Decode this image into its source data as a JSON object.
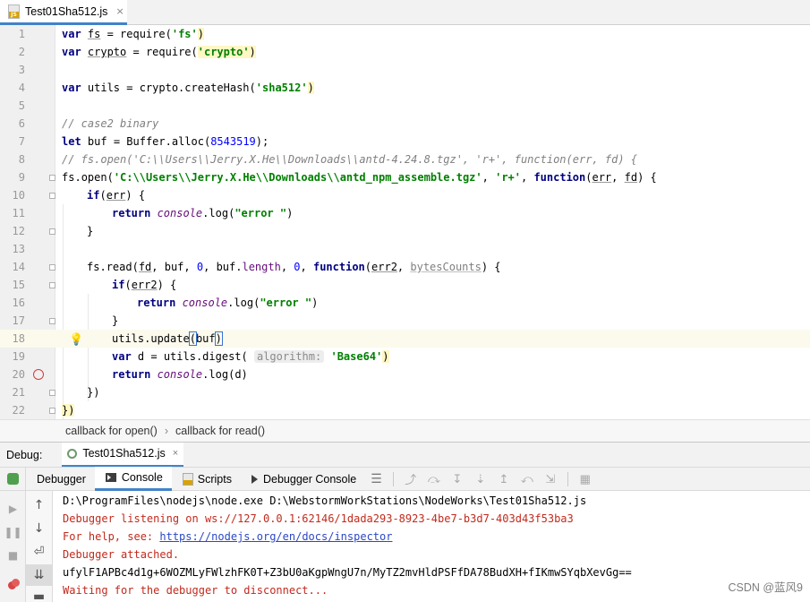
{
  "tab": {
    "filename": "Test01Sha512.js",
    "close": "×"
  },
  "editor": {
    "line_numbers": [
      "1",
      "2",
      "3",
      "4",
      "5",
      "6",
      "7",
      "8",
      "9",
      "10",
      "11",
      "12",
      "13",
      "14",
      "15",
      "16",
      "17",
      "18",
      "19",
      "20",
      "21",
      "22"
    ]
  },
  "code": {
    "l1": {
      "a": "var ",
      "b": "fs",
      "c": " = require(",
      "d": "'fs'",
      "e": ")"
    },
    "l2": {
      "a": "var ",
      "b": "crypto",
      "c": " = require(",
      "d": "'crypto'",
      "e": ")"
    },
    "l4": {
      "a": "var ",
      "b": "utils",
      "c": " = crypto.",
      "d": "createHash",
      "e": "(",
      "f": "'sha512'",
      "g": ")"
    },
    "l6": {
      "a": "// case2 binary"
    },
    "l7": {
      "a": "let ",
      "b": "buf",
      "c": " = Buffer.",
      "d": "alloc",
      "e": "(",
      "f": "8543519",
      "g": ");"
    },
    "l8": {
      "a": "// fs.open('C:\\\\Users\\\\Jerry.X.He\\\\Downloads\\\\antd-4.24.8.tgz', 'r+', function(err, fd) {"
    },
    "l9": {
      "a": "fs.",
      "b": "open",
      "c": "(",
      "d": "'C:\\\\Users\\\\Jerry.X.He\\\\Downloads\\\\antd_npm_assemble.tgz'",
      "e": ", ",
      "f": "'r+'",
      "g": ", ",
      "h": "function",
      "i": "(",
      "j": "err",
      "k": ", ",
      "l": "fd",
      "m": ") {"
    },
    "l10": {
      "a": "if",
      "b": "(",
      "c": "err",
      "d": ") {"
    },
    "l11": {
      "a": "return ",
      "b": "console",
      "c": ".",
      "d": "log",
      "e": "(",
      "f": "\"error \"",
      "g": ")"
    },
    "l12": {
      "a": "}"
    },
    "l14": {
      "a": "fs.",
      "b": "read",
      "c": "(",
      "d": "fd",
      "e": ", ",
      "f": "buf",
      "g": ", ",
      "h": "0",
      "i": ", ",
      "j": "buf",
      "k": ".",
      "l": "length",
      "m": ", ",
      "n": "0",
      "o": ", ",
      "p": "function",
      "q": "(",
      "r": "err2",
      "s": ", ",
      "t": "bytesCounts",
      "u": ") {"
    },
    "l15": {
      "a": "if",
      "b": "(",
      "c": "err2",
      "d": ") {"
    },
    "l16": {
      "a": "return ",
      "b": "console",
      "c": ".",
      "d": "log",
      "e": "(",
      "f": "\"error \"",
      "g": ")"
    },
    "l17": {
      "a": "}"
    },
    "l18": {
      "a": "utils",
      "b": ".",
      "c": "update",
      "d": "(",
      "e": "buf",
      "f": ")"
    },
    "l19": {
      "a": "var ",
      "b": "d",
      "c": " = utils.",
      "d": "digest",
      "e": "( ",
      "f": "algorithm:",
      "g": " ",
      "h": "'Base64'",
      "i": ")"
    },
    "l20": {
      "a": "return ",
      "b": "console",
      "c": ".",
      "d": "log",
      "e": "(",
      "f": "d",
      "g": ")"
    },
    "l21": {
      "a": "})"
    },
    "l22": {
      "a": "})"
    }
  },
  "breadcrumb": {
    "first": "callback for open()",
    "separator": "›",
    "second": "callback for read()"
  },
  "debug": {
    "title": "Debug:",
    "session_tab": "Test01Sha512.js",
    "session_close": "×",
    "toolbar": {
      "debugger": "Debugger",
      "console": "Console",
      "scripts": "Scripts",
      "debugger_console": "Debugger Console",
      "menu": "☰"
    }
  },
  "console": {
    "line1": "D:\\ProgramFiles\\nodejs\\node.exe D:\\WebstormWorkStations\\NodeWorks\\Test01Sha512.js",
    "line2": "Debugger listening on ws://127.0.0.1:62146/1dada293-8923-4be7-b3d7-403d43f53ba3",
    "line3_prefix": "For help, see: ",
    "line3_link": "https://nodejs.org/en/docs/inspector",
    "line4": "Debugger attached.",
    "line5": "ufylF1APBc4d1g+6WOZMLyFWlzhFK0T+Z3bU0aKgpWngU7n/MyTZ2mvHldPSFfDA78BudXH+fIKmwSYqbXevGg==",
    "line6": "Waiting for the debugger to disconnect..."
  },
  "watermark": "CSDN @蓝风9",
  "colors": {
    "accent": "#4083c9",
    "current_line": "#fcfaed",
    "keyword": "#000080",
    "string": "#008000",
    "error_red": "#c22a1c"
  }
}
